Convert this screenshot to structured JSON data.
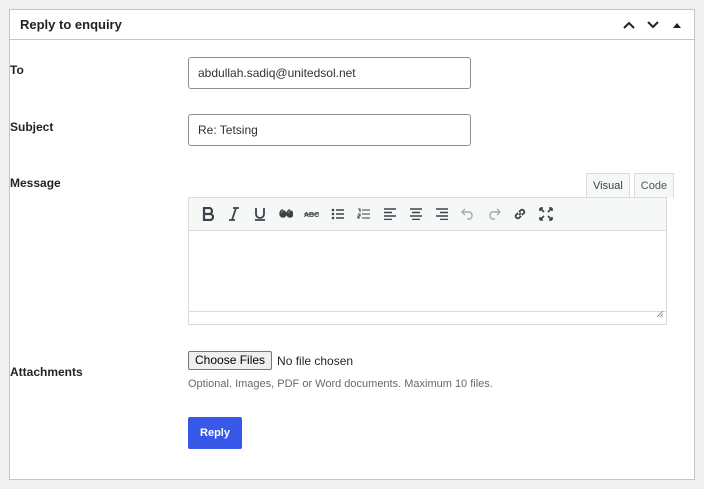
{
  "panel": {
    "title": "Reply to enquiry"
  },
  "form": {
    "to_label": "To",
    "to_value": "abdullah.sadiq@unitedsol.net",
    "subject_label": "Subject",
    "subject_value": "Re: Tetsing",
    "message_label": "Message",
    "attachments_label": "Attachments"
  },
  "editor": {
    "tabs": [
      "Visual",
      "Code"
    ],
    "active_tab": "Visual",
    "toolbar_icons": [
      "bold-icon",
      "italic-icon",
      "underline-icon",
      "blockquote-icon",
      "strikethrough-icon",
      "bullet-list-icon",
      "numbered-list-icon",
      "align-left-icon",
      "align-center-icon",
      "align-right-icon",
      "undo-icon",
      "redo-icon",
      "link-icon",
      "fullscreen-icon"
    ],
    "content": ""
  },
  "attachments": {
    "choose_label": "Choose Files",
    "status": "No file chosen",
    "help": "Optional. Images, PDF or Word documents. Maximum 10 files."
  },
  "actions": {
    "reply_label": "Reply"
  },
  "colors": {
    "primary": "#3858e9",
    "border": "#c3c4c7",
    "background": "#f0f0f1"
  }
}
